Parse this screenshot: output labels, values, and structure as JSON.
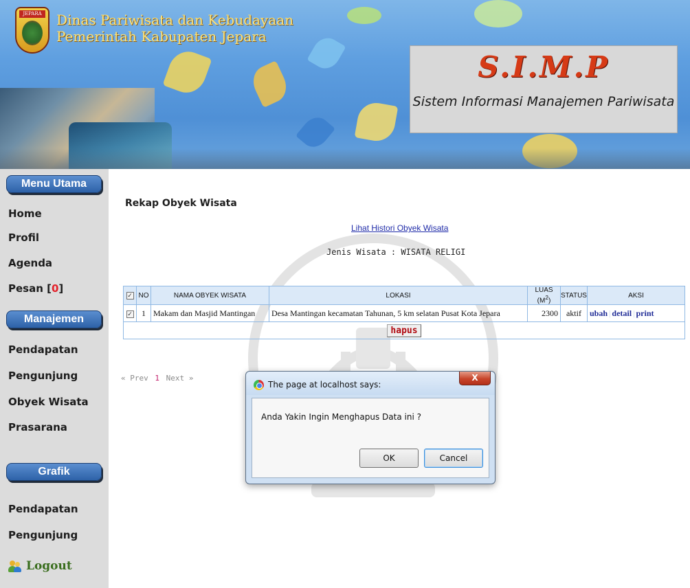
{
  "header": {
    "emblem_tag": "JEPARA",
    "agency_line1": "Dinas Pariwisata dan Kebudayaan",
    "agency_line2": "Pemerintah Kabupaten Jepara",
    "app_title": "S.I.M.P",
    "app_subtitle": "Sistem Informasi Manajemen Pariwisata"
  },
  "sidebar": {
    "menu_utama": "Menu Utama",
    "main_items": [
      {
        "label": "Home"
      },
      {
        "label": "Profil"
      },
      {
        "label": "Agenda"
      }
    ],
    "pesan": {
      "label": "Pesan [",
      "count": "0",
      "suffix": "]"
    },
    "manajemen": "Manajemen",
    "manajemen_items": [
      {
        "label": "Pendapatan"
      },
      {
        "label": "Pengunjung"
      },
      {
        "label": "Obyek Wisata"
      },
      {
        "label": "Prasarana"
      }
    ],
    "grafik": "Grafik",
    "grafik_items": [
      {
        "label": "Pendapatan"
      },
      {
        "label": "Pengunjung"
      }
    ],
    "logout": "Logout"
  },
  "main": {
    "title": "Rekap Obyek Wisata",
    "history_link": "Lihat Histori Obyek Wisata",
    "jenis": "Jenis Wisata : WISATA RELIGI",
    "table": {
      "headers": {
        "no": "NO",
        "nama": "NAMA OBYEK WISATA",
        "lokasi": "LOKASI",
        "luas": "LUAS (M",
        "luas_sup": "2",
        "luas_close": ")",
        "status": "STATUS",
        "aksi": "AKSI"
      },
      "rows": [
        {
          "checked": true,
          "no": "1",
          "nama": "Makam dan Masjid Mantingan",
          "lokasi": "Desa Mantingan kecamatan Tahunan, 5 km selatan Pusat Kota Jepara",
          "luas": "2300",
          "status": "aktif",
          "actions": {
            "ubah": "ubah",
            "detail": "detail",
            "print": "print"
          }
        }
      ],
      "hapus_label": "hapus"
    },
    "pager": {
      "prev": "« Prev",
      "current": "1",
      "next": "Next »"
    }
  },
  "dialog": {
    "title": "The page at localhost says:",
    "close": "X",
    "message": "Anda Yakin Ingin Menghapus Data ini ?",
    "ok": "OK",
    "cancel": "Cancel"
  }
}
